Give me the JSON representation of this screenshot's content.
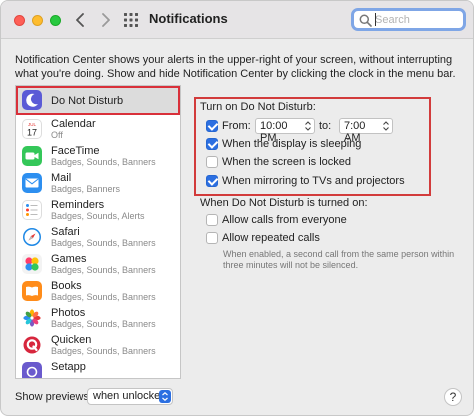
{
  "window": {
    "title": "Notifications",
    "search_placeholder": "Search"
  },
  "intro_text": "Notification Center shows your alerts in the upper-right of your screen, without interrupting what you're doing. Show and hide Notification Center by clicking the clock in the menu bar.",
  "sidebar": {
    "items": [
      {
        "name": "Do Not Disturb",
        "sub": "",
        "icon": "moon-icon",
        "color": "#5b5bd6",
        "selected": true
      },
      {
        "name": "Calendar",
        "sub": "Off",
        "icon": "calendar-icon",
        "color": "#ffffff"
      },
      {
        "name": "FaceTime",
        "sub": "Badges, Sounds, Banners",
        "icon": "facetime-icon",
        "color": "#34c759"
      },
      {
        "name": "Mail",
        "sub": "Badges, Banners",
        "icon": "mail-icon",
        "color": "#2d8ff0"
      },
      {
        "name": "Reminders",
        "sub": "Badges, Sounds, Alerts",
        "icon": "reminders-icon",
        "color": "#ffffff"
      },
      {
        "name": "Safari",
        "sub": "Badges, Sounds, Banners",
        "icon": "safari-icon",
        "color": "#1e88e5"
      },
      {
        "name": "Games",
        "sub": "Badges, Sounds, Banners",
        "icon": "games-icon",
        "color": "#7c4dff"
      },
      {
        "name": "Books",
        "sub": "Badges, Sounds, Banners",
        "icon": "books-icon",
        "color": "#ff8c1a"
      },
      {
        "name": "Photos",
        "sub": "Badges, Sounds, Banners",
        "icon": "photos-icon",
        "color": "#ffffff"
      },
      {
        "name": "Quicken",
        "sub": "Badges, Sounds, Banners",
        "icon": "quicken-icon",
        "color": "#d7263d"
      },
      {
        "name": "Setapp",
        "sub": "",
        "icon": "setapp-icon",
        "color": "#6a5acd"
      }
    ]
  },
  "calendar_icon": {
    "month": "JUL",
    "day": "17"
  },
  "dnd": {
    "heading": "Turn on Do Not Disturb:",
    "from_label": "From:",
    "from_time": "10:00 PM",
    "to_label": "to:",
    "to_time": "7:00 AM",
    "display_sleeping": "When the display is sleeping",
    "screen_locked": "When the screen is locked",
    "mirroring": "When mirroring to TVs and projectors"
  },
  "when_on": {
    "heading": "When Do Not Disturb is turned on:",
    "allow_everyone": "Allow calls from everyone",
    "allow_repeated": "Allow repeated calls",
    "footnote": "When enabled, a second call from the same person within three minutes will not be silenced."
  },
  "footer": {
    "previews_label": "Show previews:",
    "previews_value": "when unlocked",
    "help": "?"
  }
}
